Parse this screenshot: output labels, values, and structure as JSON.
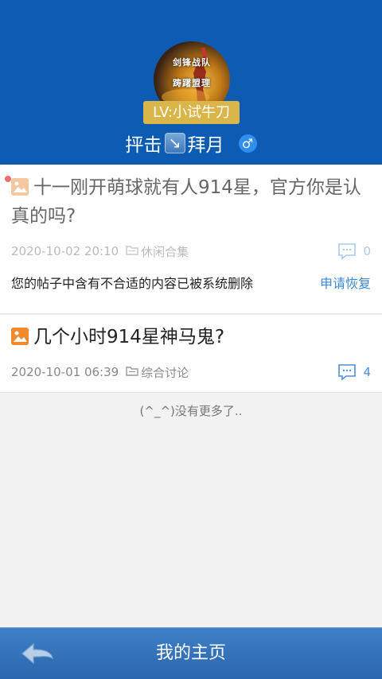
{
  "profile": {
    "avatar_text_line1": "剑锋战队",
    "avatar_text_line2": "踌躇盟理",
    "level": "LV:小试牛刀",
    "name_part1": "抨击",
    "name_emoji": "↘",
    "name_part2": "拜月",
    "gender_symbol": "♂"
  },
  "posts": [
    {
      "title": "十一刚开萌球就有人914星，官方你是认真的吗?",
      "date": "2020-10-02 20:10",
      "category": "休闲合集",
      "comments": "0",
      "notice": "您的帖子中含有不合适的内容已被系统删除",
      "action": "申请恢复"
    },
    {
      "title": "几个小时914星神马鬼?",
      "date": "2020-10-01 06:39",
      "category": "综合讨论",
      "comments": "4"
    }
  ],
  "footer_text": "(^_^)没有更多了..",
  "bottom_bar": {
    "title": "我的主页"
  },
  "colors": {
    "header_bg": "#0d5bb3",
    "badge": "#d9b54a",
    "link": "#3d88d6",
    "image_icon": "#f08a2c"
  }
}
